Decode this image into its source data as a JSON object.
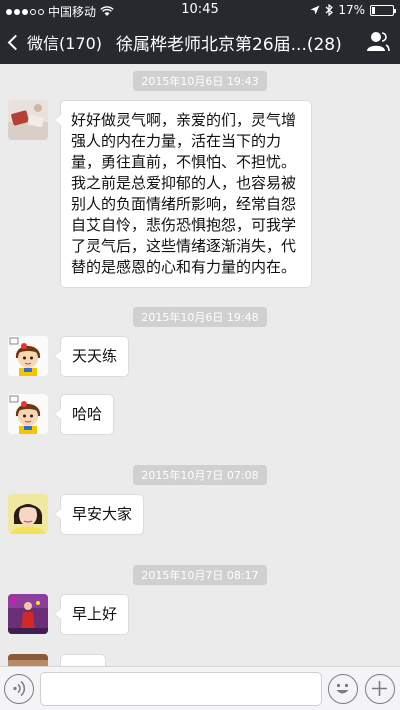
{
  "status_bar": {
    "carrier": "中国移动",
    "time": "10:45",
    "battery_text": "17%",
    "battery_level": 0.17
  },
  "nav": {
    "back_label": "微信(170)",
    "title": "徐属桦老师北京第26届...(28)"
  },
  "messages": [
    {
      "timestamp": "2015年10月6日 19:43"
    },
    {
      "text": "好好做灵气啊，亲爱的们，灵气增强人的内在力量，活在当下的力量，勇往直前，不惧怕、不担忧。我之前是总爱抑郁的人，也容易被别人的负面情绪所影响，经常自怨自艾自怜，悲伤恐惧抱怨，可我学了灵气后，这些情绪逐渐消失，代替的是感恩的心和有力量的内在。"
    },
    {
      "timestamp": "2015年10月6日 19:48"
    },
    {
      "text": "天天练"
    },
    {
      "text": "哈哈"
    },
    {
      "timestamp": "2015年10月7日 07:08"
    },
    {
      "text": "早安大家"
    },
    {
      "timestamp": "2015年10月7日 08:17"
    },
    {
      "text": "早上好"
    }
  ],
  "colors": {
    "nav_bg": "#26292e",
    "chat_bg": "#ebebeb",
    "timestamp_bg": "#d0d0d0",
    "bubble_bg": "#ffffff"
  },
  "icons": {
    "back": "chevron-left-icon",
    "group_members": "people-icon",
    "voice": "voice-icon",
    "emoji": "emoji-icon",
    "plus": "plus-icon"
  }
}
